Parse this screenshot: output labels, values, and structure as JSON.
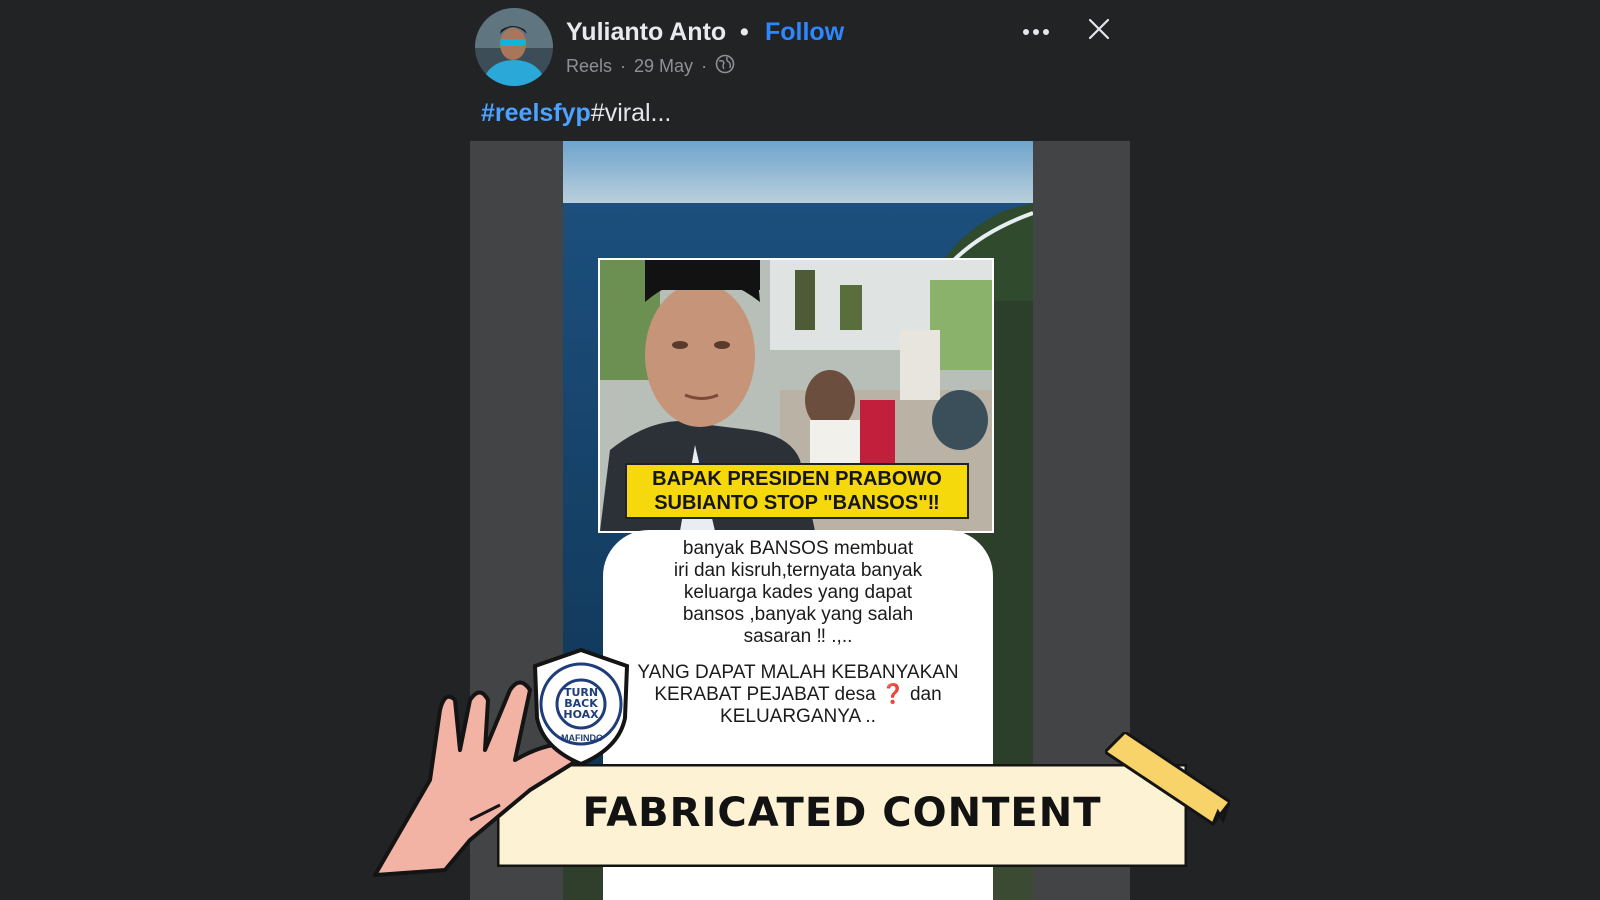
{
  "post": {
    "author": "Yulianto Anto",
    "separator_dot": "•",
    "follow_label": "Follow",
    "type": "Reels",
    "date": "29 May",
    "meta_dot": "·",
    "audience_icon": "globe-icon",
    "more_icon": "more-options-icon",
    "close_icon": "close-icon",
    "caption_hashtag": "#reelsfyp",
    "caption_rest": "#viral..."
  },
  "video": {
    "headline_line1": "BAPAK PRESIDEN PRABOWO",
    "headline_line2": "SUBIANTO STOP \"BANSOS\"‼",
    "body_line1": "banyak BANSOS membuat",
    "body_line2": "iri dan kisruh,ternyata banyak",
    "body_line3": "keluarga kades yang dapat",
    "body_line4": "bansos ,banyak yang salah",
    "body_line5": "sasaran ‼ .,..",
    "body2_line1": "YANG DAPAT MALAH KEBANYAKAN",
    "body2_line2": "KERABAT PEJABAT desa ❓ dan",
    "body2_line3": "KELUARGANYA .."
  },
  "overlay": {
    "badge_line1": "TURN",
    "badge_line2": "BACK",
    "badge_line3": "HOAX",
    "badge_bottom": "MAFINDO",
    "label": "FABRICATED CONTENT",
    "colors": {
      "ribbon": "#fdf3d4",
      "tape": "#f7d36a",
      "hand": "#f2b3a4",
      "badge_blue": "#1f3d7a"
    }
  }
}
